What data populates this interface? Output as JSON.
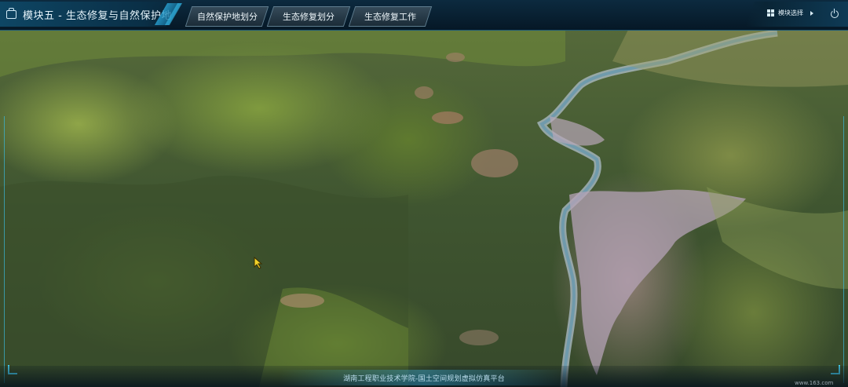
{
  "header": {
    "module_title": "模块五 - 生态修复与自然保护地",
    "tabs": [
      {
        "label": "自然保护地划分"
      },
      {
        "label": "生态修复划分"
      },
      {
        "label": "生态修复工作"
      }
    ],
    "module_select_label": "模块选择",
    "icons": {
      "title": "briefcase-icon",
      "module_select": "grid-icon",
      "arrow": "play-arrow-icon",
      "power": "power-icon"
    }
  },
  "footer": {
    "platform_text": "湖南工程职业技术学院-国土空间规划虚拟仿真平台",
    "watermark": "www.163.com"
  },
  "theme": {
    "accent": "#3ab7d8",
    "header_bg": "#0c2a3f",
    "tab_bg": "#354a59"
  }
}
